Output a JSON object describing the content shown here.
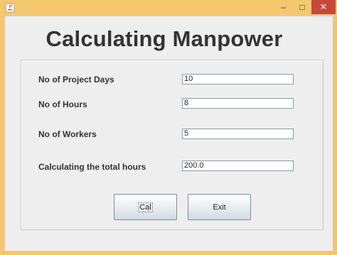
{
  "window": {
    "app_icon": "java-icon",
    "controls": {
      "minimize": "–",
      "maximize": "□",
      "close": "✕"
    }
  },
  "heading": "Calculating Manpower",
  "form": {
    "fields": [
      {
        "label": "No of Project Days",
        "value": "10"
      },
      {
        "label": "No of Hours",
        "value": "8"
      },
      {
        "label": "No of Workers",
        "value": "5"
      },
      {
        "label": "Calculating the total hours",
        "value": "200.0"
      }
    ]
  },
  "buttons": {
    "cal": "Cal",
    "exit": "Exit"
  },
  "colors": {
    "titlebar": "#f6c86e",
    "close_button": "#c7473a",
    "client_bg": "#eeeeee"
  }
}
